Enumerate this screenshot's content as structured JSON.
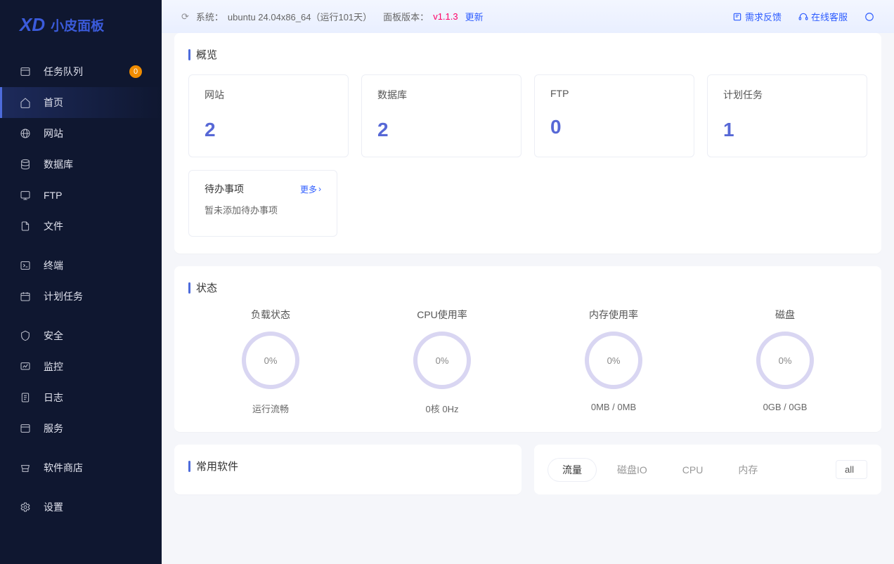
{
  "logo": {
    "text": "小皮面板"
  },
  "sidebar": {
    "task_queue": {
      "label": "任务队列",
      "count": "0"
    },
    "items": [
      {
        "label": "首页"
      },
      {
        "label": "网站"
      },
      {
        "label": "数据库"
      },
      {
        "label": "FTP"
      },
      {
        "label": "文件"
      },
      {
        "label": "终端"
      },
      {
        "label": "计划任务"
      },
      {
        "label": "安全"
      },
      {
        "label": "监控"
      },
      {
        "label": "日志"
      },
      {
        "label": "服务"
      },
      {
        "label": "软件商店"
      },
      {
        "label": "设置"
      }
    ]
  },
  "topbar": {
    "system_prefix": "系统：",
    "system_value": "ubuntu 24.04x86_64（运行101天）",
    "panel_prefix": "面板版本：",
    "version": "v1.1.3",
    "update": "更新",
    "feedback": "需求反馈",
    "support": "在线客服"
  },
  "overview": {
    "title": "概览",
    "cards": [
      {
        "label": "网站",
        "value": "2"
      },
      {
        "label": "数据库",
        "value": "2"
      },
      {
        "label": "FTP",
        "value": "0"
      },
      {
        "label": "计划任务",
        "value": "1"
      }
    ],
    "todo": {
      "title": "待办事项",
      "more": "更多",
      "empty": "暂未添加待办事项"
    }
  },
  "status": {
    "title": "状态",
    "items": [
      {
        "label": "负载状态",
        "percent": "0%",
        "sub": "运行流畅"
      },
      {
        "label": "CPU使用率",
        "percent": "0%",
        "sub": "0核 0Hz"
      },
      {
        "label": "内存使用率",
        "percent": "0%",
        "sub": "0MB / 0MB"
      },
      {
        "label": "磁盘",
        "percent": "0%",
        "sub": "0GB / 0GB"
      }
    ]
  },
  "software": {
    "title": "常用软件"
  },
  "traffic": {
    "tabs": [
      "流量",
      "磁盘IO",
      "CPU",
      "内存"
    ],
    "select": "all"
  }
}
